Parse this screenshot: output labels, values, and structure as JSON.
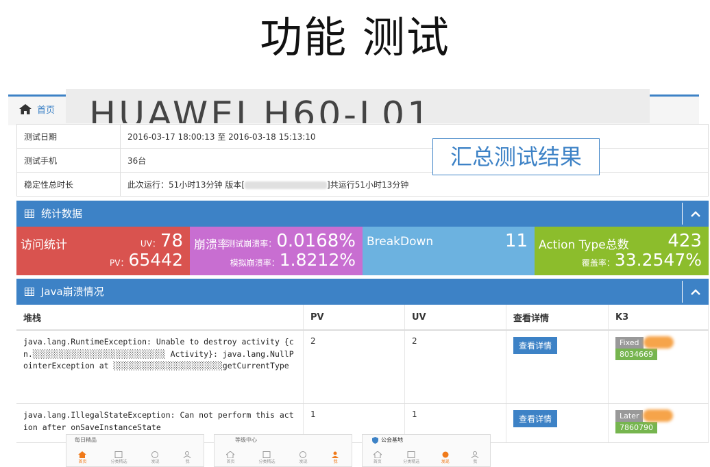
{
  "page_title": "功能 测试",
  "breadcrumb": {
    "home": "首页"
  },
  "device": "HUAWEI H60-L01",
  "summary_label": "汇总测试结果",
  "info": {
    "rows": [
      {
        "label": "测试日期",
        "value": "2016-03-17 18:00:13  至  2016-03-18 15:13:10"
      },
      {
        "label": "测试手机",
        "value": "36台"
      },
      {
        "label": "稳定性总时长",
        "value_prefix": "此次运行：51小时13分钟  版本[",
        "value_suffix": "]共运行51小时13分钟"
      }
    ]
  },
  "stats_panel": {
    "title": "统计数据"
  },
  "stats": {
    "visits": {
      "label": "访问统计",
      "uv_label": "UV：",
      "uv": "78",
      "pv_label": "PV：",
      "pv": "65442"
    },
    "crash": {
      "label": "崩溃率",
      "test_label": "测试崩溃率：",
      "test_value": "0.0168%",
      "sim_label": "模拟崩溃率：",
      "sim_value": "1.8212%"
    },
    "breakdown": {
      "label": "BreakDown",
      "value": "11"
    },
    "action": {
      "label": "Action Type总数",
      "value": "423",
      "cover_label": "覆盖率：",
      "cover_value": "33.2547%"
    }
  },
  "java_panel": {
    "title": "Java崩溃情况"
  },
  "table": {
    "headers": [
      "堆栈",
      "PV",
      "UV",
      "查看详情",
      "K3"
    ],
    "rows": [
      {
        "stack": "java.lang.RuntimeException: Unable to destroy activity {cn.░░░░░░░░░░░░░░░░░░░░░░░░░░░░ Activity}: java.lang.NullPointerException at ░░░░░░░░░░░░░░░░░░░░░░░getCurrentType",
        "pv": "2",
        "uv": "2",
        "detail": "查看详情",
        "status": "Fixed",
        "ticket": "8034669"
      },
      {
        "stack": "java.lang.IllegalStateException: Can not perform this action after onSaveInstanceState",
        "pv": "1",
        "uv": "1",
        "detail": "查看详情",
        "status": "Later",
        "ticket": "7860790"
      }
    ]
  },
  "phones": [
    {
      "section": "每日精品",
      "nav": [
        "首页",
        "分类精选",
        "发现",
        "我"
      ],
      "active": 0
    },
    {
      "section": "等级中心",
      "nav": [
        "首页",
        "分类精选",
        "发现",
        "我"
      ],
      "active": 3
    },
    {
      "section": "公会基地",
      "nav": [
        "首页",
        "分类精选",
        "发现",
        "我"
      ],
      "active": 2
    }
  ],
  "colors": {
    "primary": "#3d82c6",
    "visits": "#d9534f",
    "crash": "#c86ed1",
    "breakdown": "#6cb2e0",
    "action": "#8cbd2c",
    "tag_green": "#76b54f"
  }
}
